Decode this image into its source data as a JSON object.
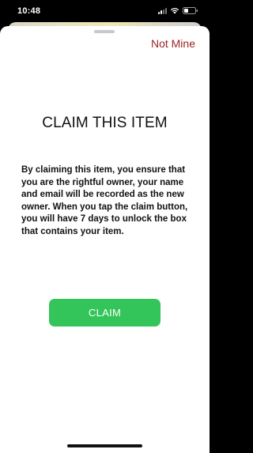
{
  "status_bar": {
    "time": "10:48",
    "icons": [
      "signal-icon",
      "wifi-icon",
      "battery-icon"
    ]
  },
  "sheet": {
    "not_mine_label": "Not Mine",
    "title": "CLAIM THIS ITEM",
    "description": "By claiming this item, you ensure that you are the rightful owner, your name and email will be recorded as the new owner. When you tap the claim button, you will have 7 days to unlock the box that contains your item.",
    "claim_label": "CLAIM"
  },
  "colors": {
    "accent_green": "#34c55a",
    "not_mine_red": "#9b2424"
  }
}
